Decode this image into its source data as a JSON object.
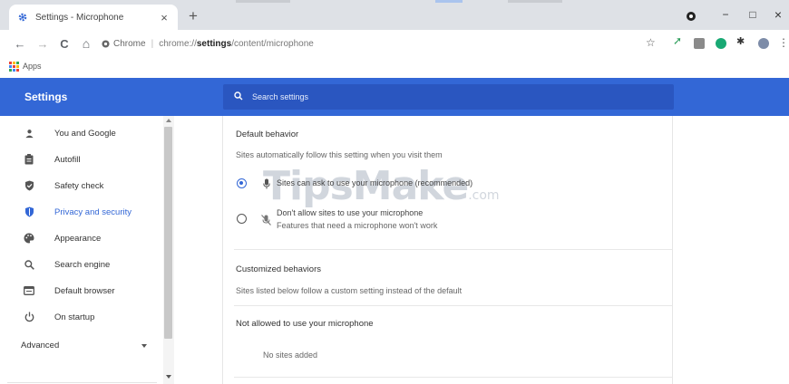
{
  "browser": {
    "tab_title": "Settings - Microphone",
    "tab_close": "×",
    "new_tab": "+",
    "minimize": "−",
    "maximize": "□",
    "close": "×"
  },
  "toolbar": {
    "back": "←",
    "forward": "→",
    "reload": "C",
    "home": "⌂",
    "site_label": "Chrome",
    "url_scheme": "chrome://",
    "url_bold": "settings",
    "url_rest": "/content/microphone",
    "star": "☆",
    "menu": "⋮"
  },
  "bookmarks": {
    "apps_label": "Apps",
    "apps_colors": [
      "#ea4335",
      "#fbbc04",
      "#34a853",
      "#4285f4",
      "#ea4335",
      "#fbbc04",
      "#34a853",
      "#4285f4",
      "#ea4335"
    ]
  },
  "settings_header": {
    "title": "Settings",
    "search_placeholder": "Search settings"
  },
  "sidebar": {
    "items": [
      {
        "label": "You and Google",
        "icon": "person-icon"
      },
      {
        "label": "Autofill",
        "icon": "clipboard-icon"
      },
      {
        "label": "Safety check",
        "icon": "shield-check-icon"
      },
      {
        "label": "Privacy and security",
        "icon": "shield-icon",
        "active": true
      },
      {
        "label": "Appearance",
        "icon": "palette-icon"
      },
      {
        "label": "Search engine",
        "icon": "search-icon"
      },
      {
        "label": "Default browser",
        "icon": "browser-icon"
      },
      {
        "label": "On startup",
        "icon": "power-icon"
      }
    ],
    "advanced_label": "Advanced"
  },
  "content": {
    "default_behavior_title": "Default behavior",
    "default_behavior_desc": "Sites automatically follow this setting when you visit them",
    "option_ask_label": "Sites can ask to use your microphone (recommended)",
    "option_ask_selected": true,
    "option_block_label": "Don't allow sites to use your microphone",
    "option_block_sub": "Features that need a microphone won't work",
    "customized_title": "Customized behaviors",
    "customized_desc": "Sites listed below follow a custom setting instead of the default",
    "not_allowed_title": "Not allowed to use your microphone",
    "no_sites": "No sites added"
  },
  "watermark": {
    "text": "TipsMake",
    "suffix": ".com"
  },
  "colors": {
    "accent": "#3367d6",
    "header_bg": "#3367d6",
    "search_bg": "#2a56c0"
  }
}
